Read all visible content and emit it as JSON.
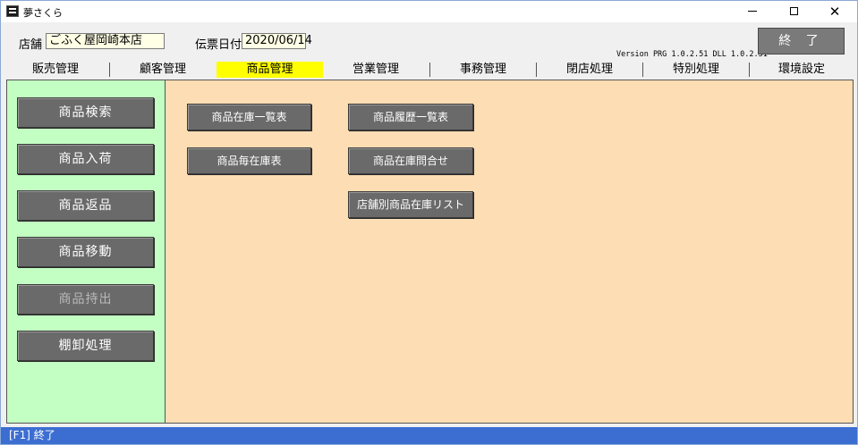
{
  "window": {
    "title": "夢さくら"
  },
  "header": {
    "store_label": "店舗",
    "store_value": "ごふく屋岡崎本店",
    "date_label": "伝票日付",
    "date_value": "2020/06/14",
    "version": "Version PRG 1.0.2.51 DLL 1.0.2.51",
    "exit_label": "終 了"
  },
  "tabs": [
    {
      "label": "販売管理"
    },
    {
      "label": "顧客管理"
    },
    {
      "label": "商品管理",
      "active": true
    },
    {
      "label": "営業管理"
    },
    {
      "label": "事務管理"
    },
    {
      "label": "閉店処理"
    },
    {
      "label": "特別処理"
    },
    {
      "label": "環境設定"
    }
  ],
  "sidebar": {
    "items": [
      {
        "label": "商品検索"
      },
      {
        "label": "商品入荷"
      },
      {
        "label": "商品返品"
      },
      {
        "label": "商品移動"
      },
      {
        "label": "商品持出",
        "disabled": true
      },
      {
        "label": "棚卸処理"
      }
    ]
  },
  "main": {
    "buttons": [
      {
        "label": "商品在庫一覧表"
      },
      {
        "label": "商品毎在庫表"
      },
      {
        "label": "商品履歴一覧表"
      },
      {
        "label": "商品在庫問合せ"
      },
      {
        "label": "店舗別商品在庫リスト"
      }
    ]
  },
  "status": {
    "text": "[F1] 終了"
  },
  "colors": {
    "active_tab": "#ffff00",
    "sidebar_bg": "#c3ffc3",
    "content_bg": "#fdddb3",
    "button_bg": "#6a6a6a",
    "statusbar_bg": "#3c6ed2"
  }
}
